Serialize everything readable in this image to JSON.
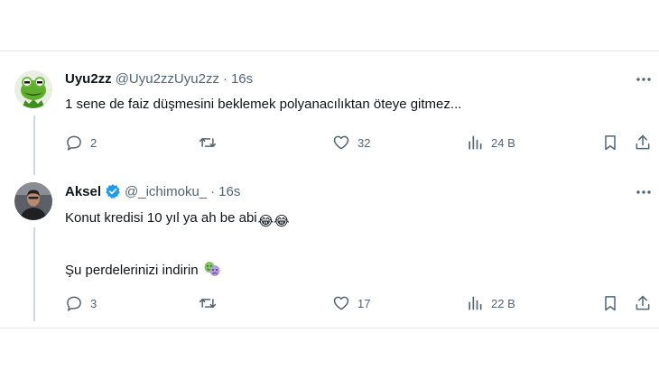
{
  "tweets": [
    {
      "name": "Uyu2zz",
      "handle": "@Uyu2zzUyu2zz",
      "separator": "·",
      "time": "16s",
      "text": "1 sene de faiz düşmesini beklemek polyanacılıktan öteye gitmez...",
      "replies": "2",
      "retweets": "",
      "likes": "32",
      "views": "24 B",
      "verified": false,
      "avatar_icon": "kermit-avatar"
    },
    {
      "name": "Aksel",
      "handle": "@_ichimoku_",
      "separator": "·",
      "time": "16s",
      "text_line1": "Konut kredisi 10 yıl ya ah be abi",
      "text_line1_emoji": "😂😂",
      "text_line2": "Şu perdelerinizi indirin",
      "text_line2_emoji": "🎭",
      "replies": "3",
      "retweets": "",
      "likes": "17",
      "views": "22 B",
      "verified": true,
      "avatar_icon": "person-avatar"
    }
  ],
  "colors": {
    "text": "#0f1419",
    "secondary": "#536471",
    "verified_blue": "#1d9bf0",
    "divider": "#e6e9ec",
    "thread_line": "#cfd9de"
  }
}
